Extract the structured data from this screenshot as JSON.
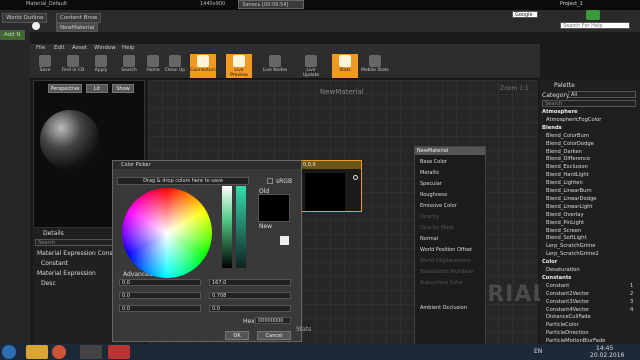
{
  "top": {
    "app_title": "Material_Default",
    "recording": "Запись [00:06:54]",
    "resolution": "1440x900",
    "project": "Project_1",
    "search_engine": "Google",
    "search_placeholder": "Search For Help"
  },
  "tabs": {
    "outer_1": "World Outline",
    "outer_2": "Content Brow",
    "outer_add": "Add N",
    "editor": "NewMaterial"
  },
  "menu": {
    "file": "File",
    "edit": "Edit",
    "asset": "Asset",
    "window": "Window",
    "help": "Help"
  },
  "toolbar": [
    "Save",
    "Find in CB",
    "Apply",
    "Search",
    "Home",
    "Clean Up",
    "Connectors",
    "Live Preview",
    "Live Nodes",
    "Live Update",
    "Stats",
    "Mobile Stats"
  ],
  "viewport": {
    "perspective": "Perspective",
    "lit": "Lit",
    "show": "Show"
  },
  "details": {
    "title": "Details",
    "search": "Search",
    "expr_const": "Material Expression Consta",
    "constant": "Constant",
    "expr": "Material Expression",
    "desc": "Desc"
  },
  "graph": {
    "title": "NewMaterial",
    "zoom": "Zoom 1:1",
    "watermark": "MATERIAL",
    "node": "0,0,0",
    "stats": "Stats"
  },
  "material_node": {
    "title": "NewMaterial",
    "pins": [
      "Base Color",
      "Metallic",
      "Specular",
      "Roughness",
      "Emissive Color",
      "Opacity",
      "Opacity Mask",
      "Normal",
      "World Position Offset",
      "World Displacement",
      "Tessellation Multiplier",
      "Subsurface Color",
      "Ambient Occlusion"
    ]
  },
  "palette": {
    "title": "Palette",
    "category_label": "Category",
    "category": "All",
    "search": "Search",
    "items": [
      {
        "t": "Atmosphere",
        "cat": true
      },
      {
        "t": "AtmosphericFogColor"
      },
      {
        "t": "Blends",
        "cat": true
      },
      {
        "t": "Blend_ColorBurn"
      },
      {
        "t": "Blend_ColorDodge"
      },
      {
        "t": "Blend_Darken"
      },
      {
        "t": "Blend_Difference"
      },
      {
        "t": "Blend_Exclusion"
      },
      {
        "t": "Blend_HardLight"
      },
      {
        "t": "Blend_Lighten"
      },
      {
        "t": "Blend_LinearBurn"
      },
      {
        "t": "Blend_LinearDodge"
      },
      {
        "t": "Blend_LinearLight"
      },
      {
        "t": "Blend_Overlay"
      },
      {
        "t": "Blend_PinLight"
      },
      {
        "t": "Blend_Screen"
      },
      {
        "t": "Blend_SoftLight"
      },
      {
        "t": "Lerp_ScratchGrime"
      },
      {
        "t": "Lerp_ScratchGrime2"
      },
      {
        "t": "Color",
        "cat": true
      },
      {
        "t": "Desaturation"
      },
      {
        "t": "Constants",
        "cat": true
      },
      {
        "t": "Constant",
        "n": "1"
      },
      {
        "t": "Constant2Vector",
        "n": "2"
      },
      {
        "t": "Constant3Vector",
        "n": "3"
      },
      {
        "t": "Constant4Vector",
        "n": "4"
      },
      {
        "t": "DistanceCullFade"
      },
      {
        "t": "ParticleColor"
      },
      {
        "t": "ParticleDirection"
      },
      {
        "t": "ParticleMotionBlurFade"
      },
      {
        "t": "ParticleRadius"
      }
    ]
  },
  "color_picker": {
    "title": "Color Picker",
    "drop_hint": "Drag & drop colors here to save",
    "srgb": "sRGB",
    "old": "Old",
    "new": "New",
    "advanced": "Advanced",
    "r": "0.0",
    "g": "0.0",
    "b": "0.0",
    "h": "167.0",
    "s": "0.708",
    "v": "0.0",
    "hex_label": "Hex",
    "hex": "00000000",
    "ok": "OK",
    "cancel": "Cancel"
  },
  "taskbar": {
    "lang": "EN",
    "time": "14:45",
    "date": "20.02.2016"
  }
}
